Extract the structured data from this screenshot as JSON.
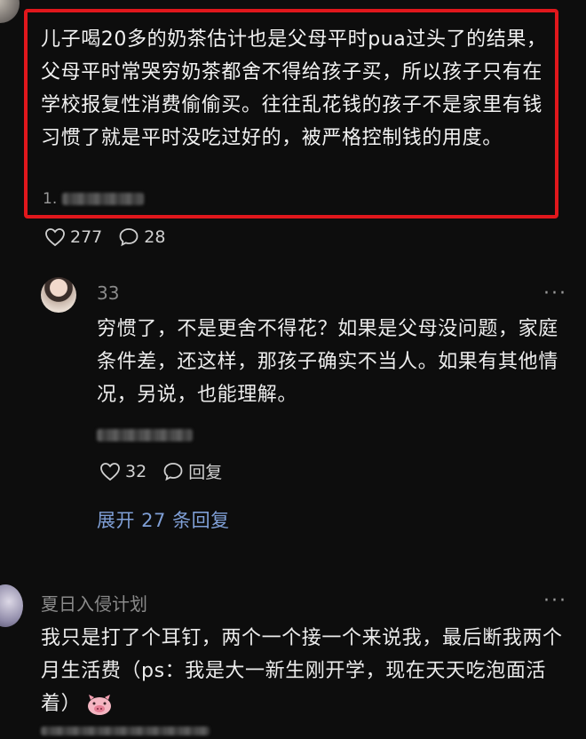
{
  "comment1": {
    "text": "儿子喝20多的奶茶估计也是父母平时pua过头了的结果，父母平时常哭穷奶茶都舍不得给孩子买，所以孩子只有在学校报复性消费偷偷买。往往乱花钱的孩子不是家里有钱习惯了就是平时没吃过好的，被严格控制钱的用度。",
    "time_prefix": "1.",
    "likes": "277",
    "replies": "28"
  },
  "comment2": {
    "username": "33",
    "more": "···",
    "text": "穷惯了，不是更舍不得花？如果是父母没问题，家庭条件差，还这样，那孩子确实不当人。如果有其他情况，另说，也能理解。",
    "likes": "32",
    "reply_label": "回复",
    "expand_label": "展开 27 条回复"
  },
  "comment3": {
    "username": "夏日入侵计划",
    "more": "···",
    "text": "我只是打了个耳钉，两个一个接一个来说我，最后断我两个月生活费（ps：我是大一新生刚开学，现在天天吃泡面活着）"
  },
  "colors": {
    "highlight": "#e0171c",
    "link": "#7f9fd6",
    "background": "#0d0d0d"
  },
  "icons": [
    "heart-icon",
    "comment-icon",
    "more-icon",
    "pig-emoji-icon"
  ]
}
